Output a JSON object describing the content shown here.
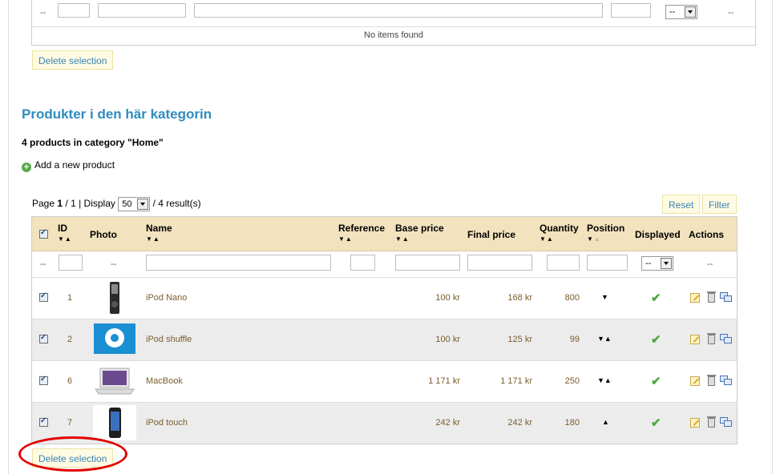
{
  "top_table": {
    "filter_dash_left": "--",
    "filter_dash_right": "--",
    "filter_select": "--",
    "empty_message": "No items found"
  },
  "delete_selection_top": "Delete selection",
  "section_title": "Produkter i den här kategorin",
  "product_count": "4 products in category \"Home\"",
  "add_product": "Add a new product",
  "pager": {
    "page_label": "Page",
    "page_current": "1",
    "page_total": "/ 1 | Display",
    "per_page": "50",
    "results": "/ 4 result(s)"
  },
  "reset_button": "Reset",
  "filter_button": "Filter",
  "columns": {
    "id": "ID",
    "photo": "Photo",
    "name": "Name",
    "reference": "Reference",
    "base_price": "Base price",
    "final_price": "Final price",
    "quantity": "Quantity",
    "position": "Position",
    "displayed": "Displayed",
    "actions": "Actions"
  },
  "filter_row": {
    "dash_select": "--",
    "dash_photo": "--",
    "dash_actions": "--",
    "displayed_select": "--"
  },
  "products": [
    {
      "id": "1",
      "name": "iPod Nano",
      "base_price": "100 kr",
      "final_price": "168 kr",
      "quantity": "800",
      "position": "▼"
    },
    {
      "id": "2",
      "name": "iPod shuffle",
      "base_price": "100 kr",
      "final_price": "125 kr",
      "quantity": "99",
      "position": "▼▲"
    },
    {
      "id": "6",
      "name": "MacBook",
      "base_price": "1 171 kr",
      "final_price": "1 171 kr",
      "quantity": "250",
      "position": "▼▲"
    },
    {
      "id": "7",
      "name": "iPod touch",
      "base_price": "242 kr",
      "final_price": "242 kr",
      "quantity": "180",
      "position": "▲"
    }
  ],
  "delete_selection_bottom": "Delete selection",
  "colors": {
    "title_blue": "#2e8cbe",
    "header_bg": "#f2e2bd",
    "highlight_red": "#e00000",
    "check_green": "#4caa3a"
  }
}
